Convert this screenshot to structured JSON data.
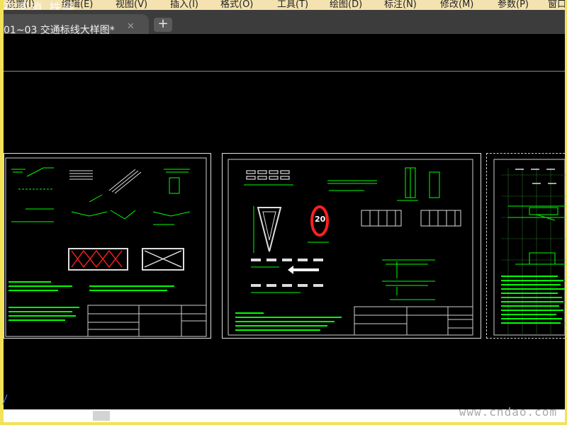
{
  "colors": {
    "accent": "#f2e25a",
    "menubar": "#f4e3b0",
    "cad_green": "#00ff00",
    "cad_red": "#ff2020",
    "sheet_border": "#e0e0e0"
  },
  "watermark_top": "存图逍 株网",
  "menu": {
    "items": [
      {
        "label": "设置(I)"
      },
      {
        "label": "编辑(E)"
      },
      {
        "label": "视图(V)"
      },
      {
        "label": "插入(I)"
      },
      {
        "label": "格式(O)"
      },
      {
        "label": "工具(T)"
      },
      {
        "label": "绘图(D)"
      },
      {
        "label": "标注(N)"
      },
      {
        "label": "修改(M)"
      },
      {
        "label": "参数(P)"
      },
      {
        "label": "窗口"
      }
    ]
  },
  "tabs": [
    {
      "label": "01~03 交通标线大样图*",
      "close_icon": "close-icon"
    }
  ],
  "new_tab_label": "+",
  "sign": {
    "speed_limit_value": "20"
  },
  "watermark_bottom": "www.cndao.com"
}
